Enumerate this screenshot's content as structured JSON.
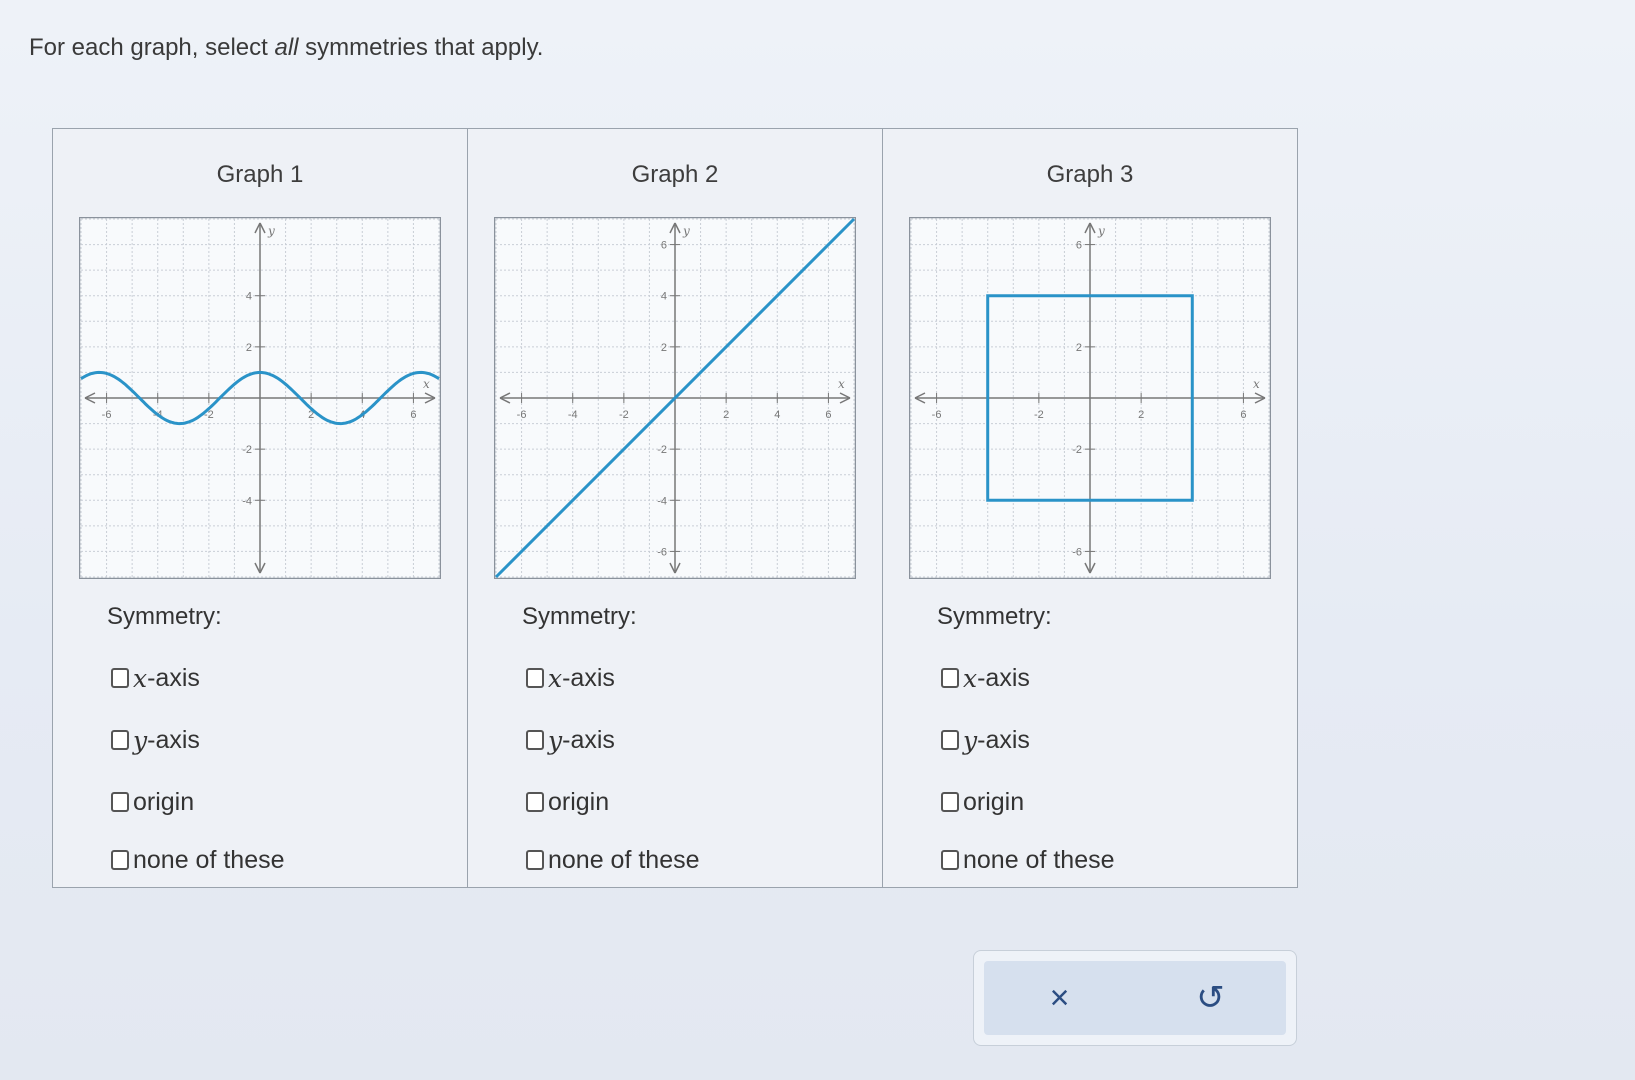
{
  "instruction": {
    "before": "For each graph, select ",
    "emphasis": "all",
    "after": " symmetries that apply."
  },
  "panels": [
    {
      "title": "Graph 1",
      "symmetry_label": "Symmetry:",
      "options": [
        {
          "var": "x",
          "text": "-axis",
          "checked": false
        },
        {
          "var": "y",
          "text": "-axis",
          "checked": false
        },
        {
          "var": "",
          "text": "origin",
          "checked": false
        },
        {
          "var": "",
          "text": "none of these",
          "checked": false
        }
      ]
    },
    {
      "title": "Graph 2",
      "symmetry_label": "Symmetry:",
      "options": [
        {
          "var": "x",
          "text": "-axis",
          "checked": false
        },
        {
          "var": "y",
          "text": "-axis",
          "checked": false
        },
        {
          "var": "",
          "text": "origin",
          "checked": false
        },
        {
          "var": "",
          "text": "none of these",
          "checked": false
        }
      ]
    },
    {
      "title": "Graph 3",
      "symmetry_label": "Symmetry:",
      "options": [
        {
          "var": "x",
          "text": "-axis",
          "checked": false
        },
        {
          "var": "y",
          "text": "-axis",
          "checked": false
        },
        {
          "var": "",
          "text": "origin",
          "checked": false
        },
        {
          "var": "",
          "text": "none of these",
          "checked": false
        }
      ]
    }
  ],
  "toolbar": {
    "clear_icon": "close-icon",
    "clear_symbol": "×",
    "undo_icon": "undo-icon",
    "undo_symbol": "↺"
  },
  "colors": {
    "curve": "#2a93c8",
    "grid": "#c9ced6",
    "axis": "#777777"
  },
  "chart_data": [
    {
      "type": "line",
      "xlabel": "x",
      "ylabel": "y",
      "xlim": [
        -7,
        7
      ],
      "ylim": [
        -7,
        7
      ],
      "x_ticks": [
        "-6",
        "-4",
        "-2",
        "2",
        "4",
        "6"
      ],
      "y_ticks": [
        "4",
        "2",
        "-2",
        "-4"
      ],
      "function": "y = cos(x)",
      "domain": [
        -7,
        7
      ],
      "grid": true
    },
    {
      "type": "line",
      "xlabel": "x",
      "ylabel": "y",
      "xlim": [
        -7,
        7
      ],
      "ylim": [
        -7,
        7
      ],
      "x_ticks": [
        "-6",
        "-4",
        "-2",
        "2",
        "4",
        "6"
      ],
      "y_ticks": [
        "6",
        "4",
        "2",
        "-2",
        "-4",
        "-6"
      ],
      "function": "y = x",
      "domain": [
        -7,
        7
      ],
      "grid": true
    },
    {
      "type": "line",
      "xlabel": "x",
      "ylabel": "y",
      "xlim": [
        -7,
        7
      ],
      "ylim": [
        -7,
        7
      ],
      "x_ticks": [
        "-6",
        "-2",
        "2",
        "6"
      ],
      "y_ticks": [
        "6",
        "2",
        "-2",
        "-6"
      ],
      "shape": "rectangle",
      "vertices": [
        [
          -4,
          4
        ],
        [
          4,
          4
        ],
        [
          4,
          -4
        ],
        [
          -4,
          -4
        ]
      ],
      "grid": true
    }
  ]
}
